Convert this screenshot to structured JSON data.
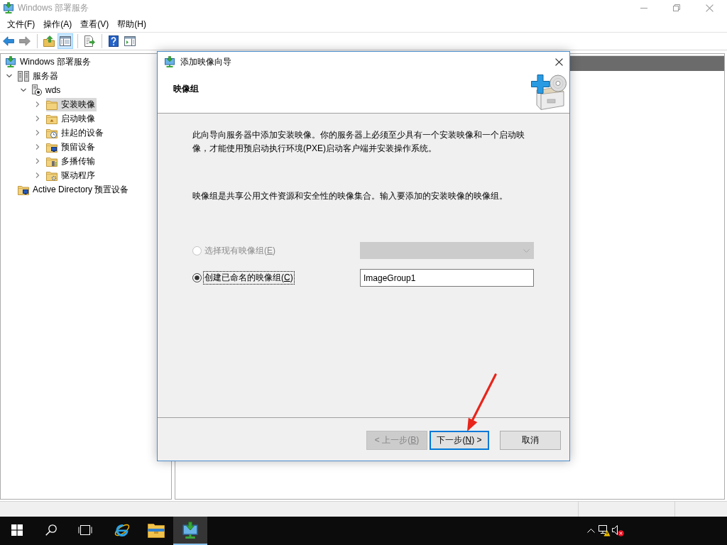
{
  "window": {
    "title": "Windows 部署服务"
  },
  "menu": [
    "文件(F)",
    "操作(A)",
    "查看(V)",
    "帮助(H)"
  ],
  "toolbar": [
    {
      "kind": "button",
      "disabled": false,
      "pressed": false
    },
    {
      "kind": "button",
      "disabled": true,
      "pressed": false
    },
    {
      "kind": "separator"
    },
    {
      "kind": "button",
      "disabled": false,
      "pressed": false
    },
    {
      "kind": "button",
      "disabled": false,
      "pressed": true
    },
    {
      "kind": "separator"
    },
    {
      "kind": "button",
      "disabled": false,
      "pressed": false
    },
    {
      "kind": "separator"
    },
    {
      "kind": "button",
      "disabled": false,
      "pressed": false
    },
    {
      "kind": "button",
      "disabled": false,
      "pressed": false
    }
  ],
  "tree": [
    {
      "label": "Windows 部署服务",
      "selected": false,
      "children": [
        {
          "label": "服务器",
          "selected": false,
          "expanded": true,
          "children": [
            {
              "label": "wds",
              "selected": false,
              "expanded": true,
              "children": [
                {
                  "label": "安装映像",
                  "selected": true,
                  "expanded": false
                },
                {
                  "label": "启动映像",
                  "selected": false,
                  "expanded": false
                },
                {
                  "label": "挂起的设备",
                  "selected": false,
                  "expanded": false
                },
                {
                  "label": "预留设备",
                  "selected": false,
                  "expanded": false
                },
                {
                  "label": "多播传输",
                  "selected": false,
                  "expanded": false
                },
                {
                  "label": "驱动程序",
                  "selected": false,
                  "expanded": false
                }
              ]
            }
          ]
        },
        {
          "label": "Active Directory 预置设备",
          "selected": false
        }
      ]
    }
  ],
  "dialog": {
    "title": "添加映像向导",
    "heading": "映像组",
    "intro": "此向导向服务器中添加安装映像。你的服务器上必须至少具有一个安装映像和一个启动映像，才能使用预启动执行环境(PXE)启动客户端并安装操作系统。",
    "description": "映像组是共享公用文件资源和安全性的映像集合。输入要添加的安装映像的映像组。",
    "options": [
      {
        "label": "选择现有映像组(E)",
        "selected": false,
        "disabled": true,
        "focused": false,
        "kind": "dropdown"
      },
      {
        "label": "创建已命名的映像组(C)",
        "selected": true,
        "disabled": false,
        "focused": true,
        "kind": "text",
        "value": "ImageGroup1"
      }
    ],
    "buttons": [
      {
        "label": "< 上一步(B)",
        "disabled": true,
        "default": false
      },
      {
        "label": "下一步(N) >",
        "disabled": false,
        "default": true
      },
      {
        "label": "取消",
        "disabled": false,
        "default": false
      }
    ]
  },
  "taskbar": {
    "apps": [
      {
        "active": false
      },
      {
        "active": false
      },
      {
        "active": true
      }
    ]
  }
}
